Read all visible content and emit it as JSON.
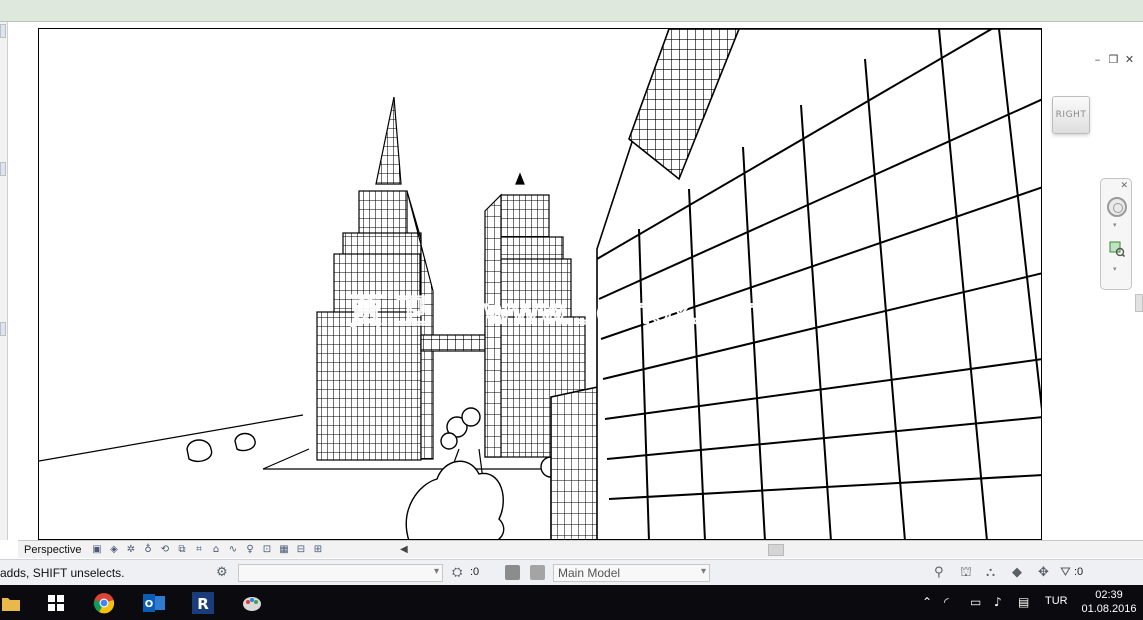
{
  "view": {
    "name": "Perspective",
    "viewcube_face": "RIGHT",
    "watermark": "贾 卫 网 www.3dmox.com"
  },
  "window_controls": {
    "minimize": "–",
    "restore": "❐",
    "close": "✕"
  },
  "status": {
    "hint": "adds, SHIFT unselects.",
    "design_option_count": ":0",
    "model": "Main Model",
    "filter_count": ":0"
  },
  "taskbar": {
    "apps": [
      "file-explorer-icon",
      "store-icon",
      "chrome-icon",
      "outlook-icon",
      "revit-icon",
      "paint-icon"
    ],
    "language": "TUR",
    "time": "02:39",
    "date": "01.08.2016"
  },
  "colors": {
    "title_strip": "#dfe8dc",
    "taskbar": "#0b0b0f",
    "status_bar": "#eef0f3"
  }
}
